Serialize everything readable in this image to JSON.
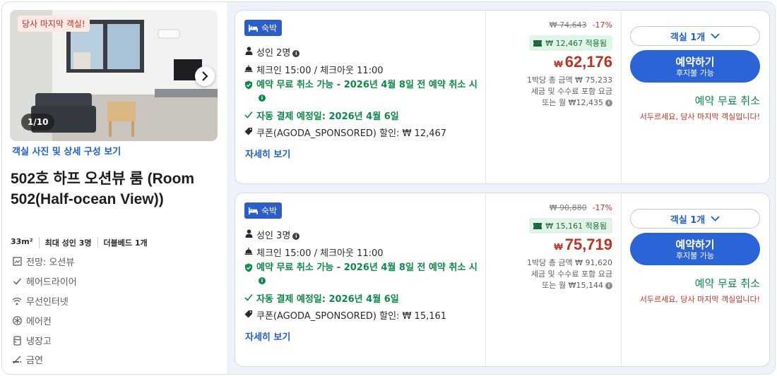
{
  "room": {
    "last_room_badge": "당사 마지막 객실!",
    "photo_counter": "1/10",
    "photo_link": "객실 사진 및 상세 구성 보기",
    "title": "502호 하프 오션뷰 룸 (Room 502(Half-ocean View))",
    "specs": [
      "33m²",
      "최대 성인 3명",
      "더블베드 1개"
    ],
    "amenities": [
      {
        "icon": "view-icon",
        "label": "전망: 오션뷰"
      },
      {
        "icon": "check-icon",
        "label": "헤어드라이어"
      },
      {
        "icon": "wifi-icon",
        "label": "무선인터넷"
      },
      {
        "icon": "snowflake-icon",
        "label": "에어컨"
      },
      {
        "icon": "fridge-icon",
        "label": "냉장고"
      },
      {
        "icon": "no-smoking-icon",
        "label": "금연"
      }
    ]
  },
  "offers": [
    {
      "stay_tag": "숙박",
      "guests": "성인 2명",
      "checkin": "체크인 15:00 / 체크아웃 11:00",
      "free_cancel": "예약 무료 취소 가능 - 2026년 4월 8일 전 예약 취소 시",
      "auto_pay": "자동 결제 예정일: 2026년 4월 6일",
      "coupon": "쿠폰(AGODA_SPONSORED) 할인: ₩ 12,467",
      "detail_link": "자세히 보기",
      "original_price": "₩ 74,643",
      "discount_pct": "-17%",
      "coupon_chip": "₩ 12,467 적용됨",
      "currency": "₩",
      "price": "62,176",
      "note_total": "1박당 총 금액 ₩ 75,233",
      "note_tax": "세금 및 수수료 포함 요금",
      "note_monthly": "또는 월 ₩12,435",
      "rooms_select": "객실 1개",
      "book_main": "예약하기",
      "book_sub": "후지불 가능",
      "free_cancel_label": "예약 무료 취소",
      "hurry": "서두르세요, 당사 마지막 객실입니다!"
    },
    {
      "stay_tag": "숙박",
      "guests": "성인 3명",
      "checkin": "체크인 15:00 / 체크아웃 11:00",
      "free_cancel": "예약 무료 취소 가능 - 2026년 4월 8일 전 예약 취소 시",
      "auto_pay": "자동 결제 예정일: 2026년 4월 6일",
      "coupon": "쿠폰(AGODA_SPONSORED) 할인: ₩ 15,161",
      "detail_link": "자세히 보기",
      "original_price": "₩ 90,880",
      "discount_pct": "-17%",
      "coupon_chip": "₩ 15,161 적용됨",
      "currency": "₩",
      "price": "75,719",
      "note_total": "1박당 총 금액 ₩ 91,620",
      "note_tax": "세금 및 수수료 포함 요금",
      "note_monthly": "또는 월 ₩15,144",
      "rooms_select": "객실 1개",
      "book_main": "예약하기",
      "book_sub": "후지불 가능",
      "free_cancel_label": "예약 무료 취소",
      "hurry": "서두르세요, 당사 마지막 객실입니다!"
    }
  ],
  "colors": {
    "accent_blue": "#2a64d6",
    "price_red": "#c4301e",
    "green": "#0b8a4a"
  }
}
